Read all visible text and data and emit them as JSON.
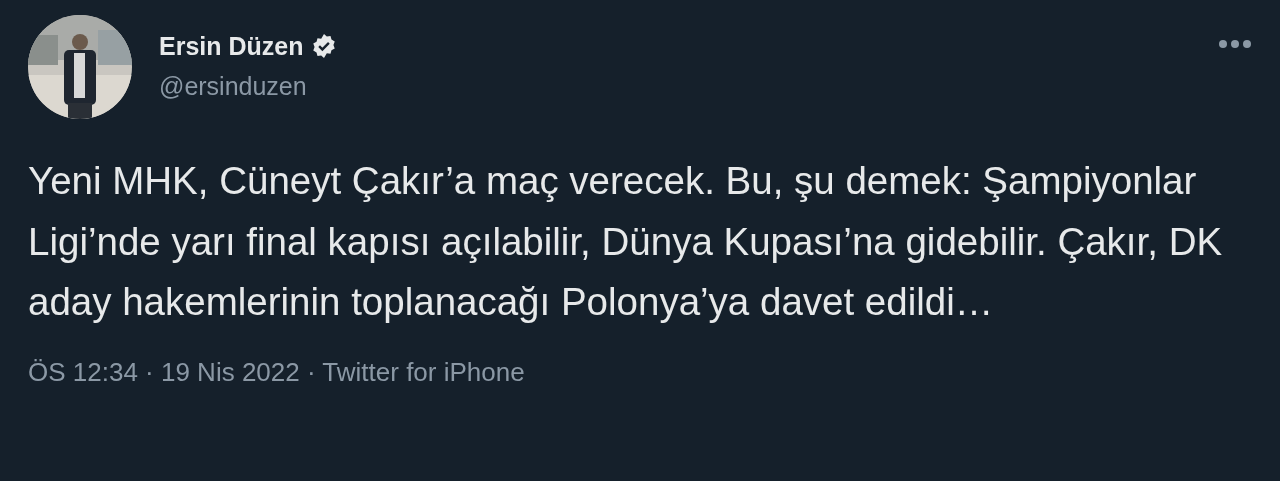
{
  "author": {
    "name": "Ersin Düzen",
    "verified": true,
    "handle": "@ersinduzen"
  },
  "menu_icon": true,
  "text": "Yeni MHK, Cüneyt Çakır’a maç verecek. Bu, şu demek: Şampiyonlar Ligi’nde yarı final kapısı açılabilir, Dünya Kupası’na gidebilir. Çakır, DK aday hakemlerinin toplanacağı Polonya’ya davet edildi…",
  "meta": "ÖS 12:34 · 19 Nis 2022 · Twitter for iPhone"
}
